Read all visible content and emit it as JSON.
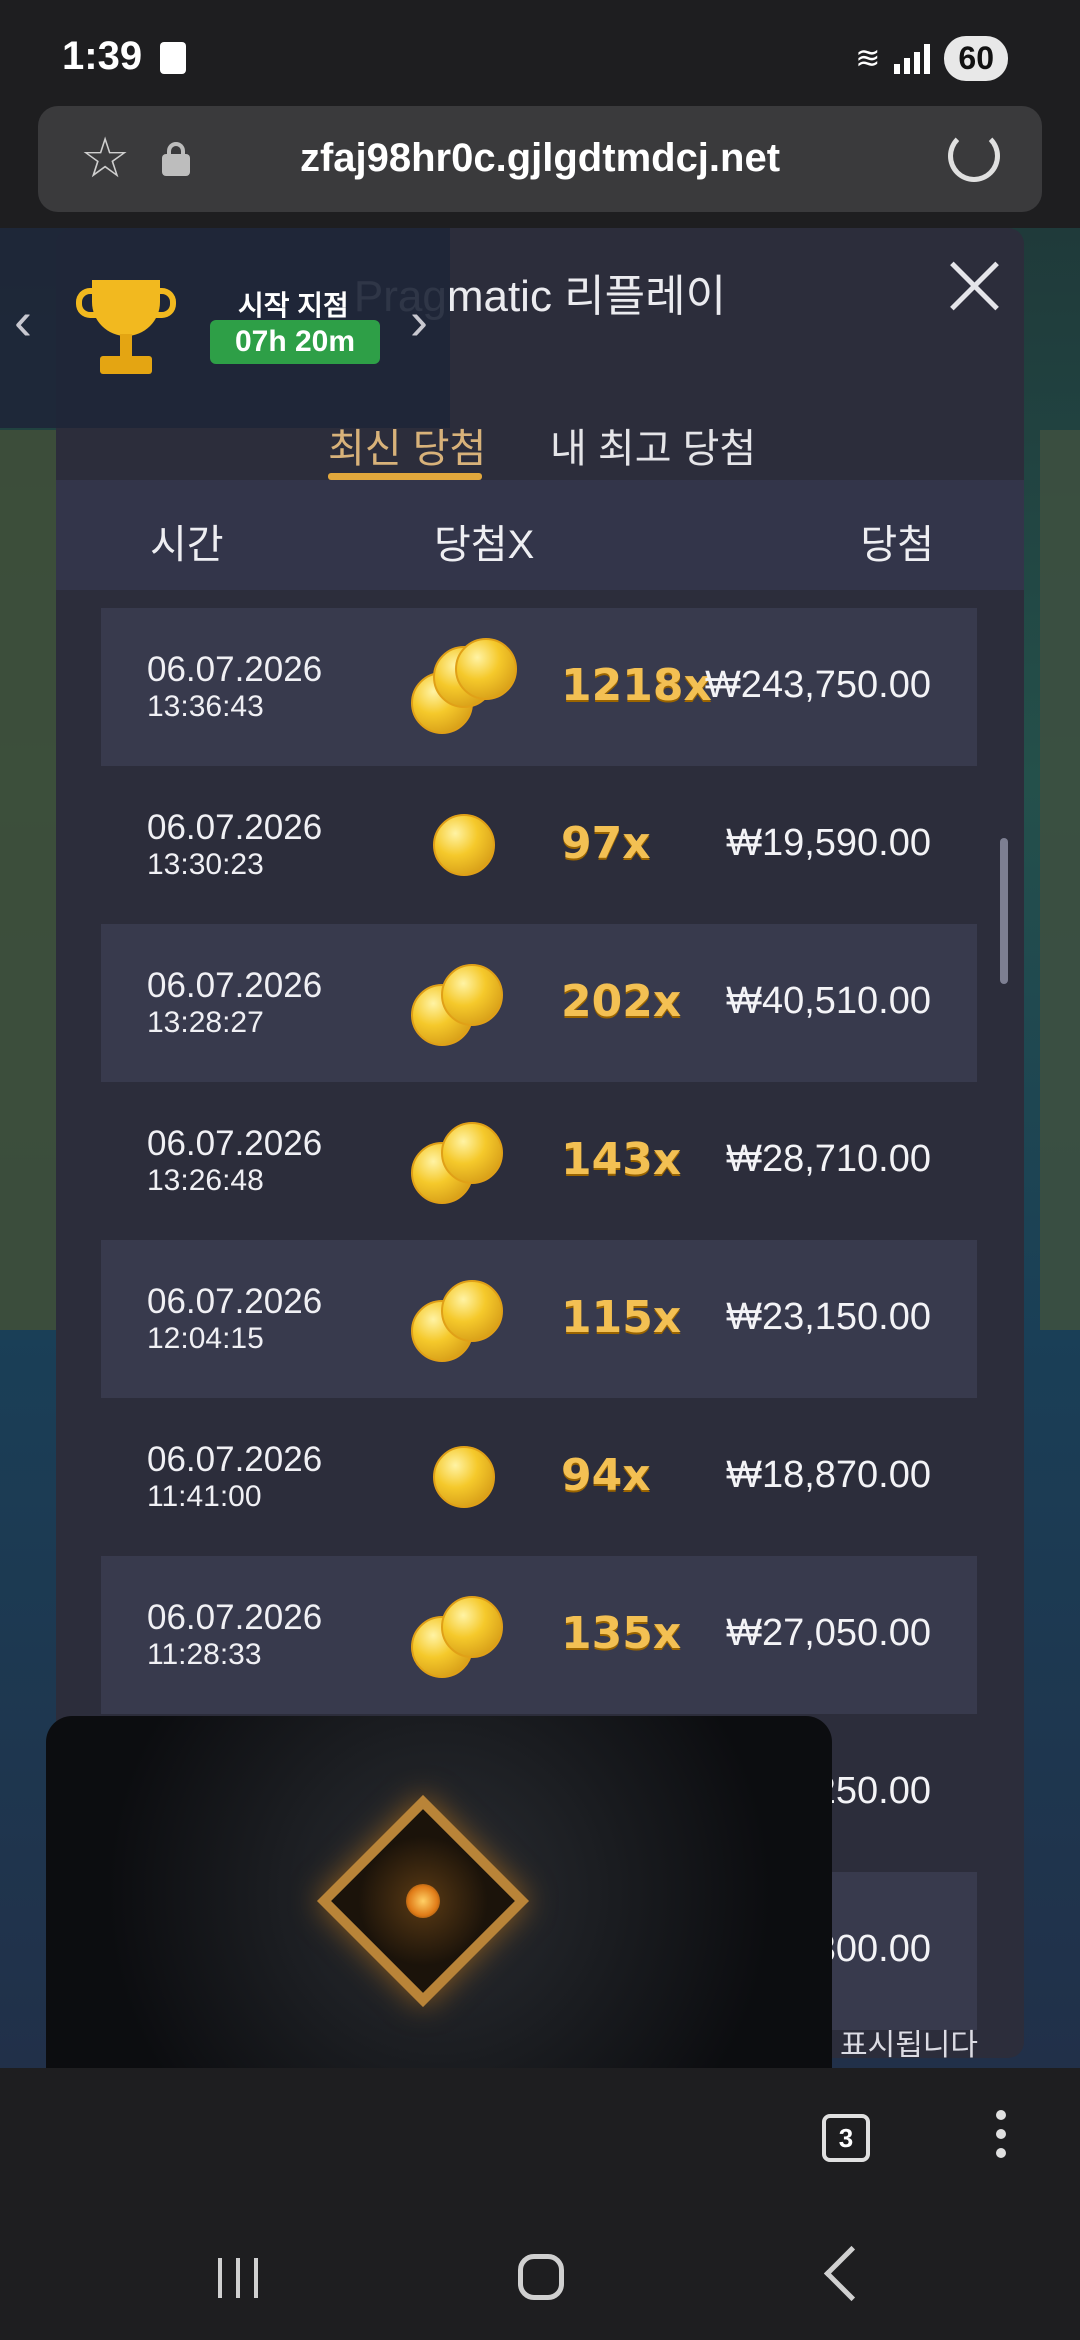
{
  "status_bar": {
    "time": "1:39",
    "battery": "60"
  },
  "browser": {
    "url": "zfaj98hr0c.gjlgdtmdcj.net",
    "tab_count": "3"
  },
  "modal": {
    "title": "Pragmatic 리플레이",
    "tabs": [
      "최신 당첨",
      "내 최고 당첨"
    ],
    "active_tab": 0,
    "columns": {
      "time": "시간",
      "multiplier": "당첨X",
      "win": "당첨"
    },
    "rows": [
      {
        "date": "06.07.2026",
        "time": "13:36:43",
        "mult": "1218x",
        "amount": "₩243,750.00",
        "coin_tier": 3
      },
      {
        "date": "06.07.2026",
        "time": "13:30:23",
        "mult": "97x",
        "amount": "₩19,590.00",
        "coin_tier": 1
      },
      {
        "date": "06.07.2026",
        "time": "13:28:27",
        "mult": "202x",
        "amount": "₩40,510.00",
        "coin_tier": 2
      },
      {
        "date": "06.07.2026",
        "time": "13:26:48",
        "mult": "143x",
        "amount": "₩28,710.00",
        "coin_tier": 2
      },
      {
        "date": "06.07.2026",
        "time": "12:04:15",
        "mult": "115x",
        "amount": "₩23,150.00",
        "coin_tier": 2
      },
      {
        "date": "06.07.2026",
        "time": "11:41:00",
        "mult": "94x",
        "amount": "₩18,870.00",
        "coin_tier": 1
      },
      {
        "date": "06.07.2026",
        "time": "11:28:33",
        "mult": "135x",
        "amount": "₩27,050.00",
        "coin_tier": 2
      },
      {
        "date": "",
        "time": "",
        "mult": "",
        "amount": "250.00",
        "coin_tier": 0
      },
      {
        "date": "",
        "time": "",
        "mult": "",
        "amount": "300.00",
        "coin_tier": 0
      }
    ],
    "footer_note": "에 표시됩니다"
  },
  "tournament": {
    "label": "시작 지점",
    "countdown": "07h 20m"
  },
  "video": {
    "health_fraction": 0.66,
    "mana_fraction": 1.0
  },
  "colors": {
    "accent": "#e2a83c",
    "timer_bg": "#2e9f47",
    "multiplier": "#f3c053"
  }
}
